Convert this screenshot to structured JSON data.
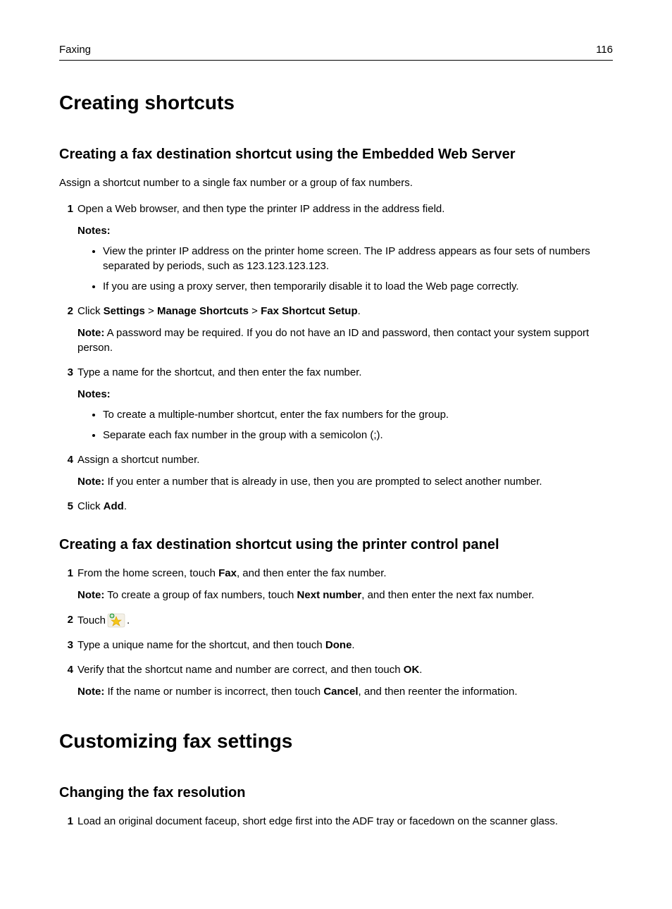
{
  "header": {
    "section": "Faxing",
    "page": "116"
  },
  "h1_a": "Creating shortcuts",
  "sec1": {
    "title": "Creating a fax destination shortcut using the Embedded Web Server",
    "intro": "Assign a shortcut number to a single fax number or a group of fax numbers.",
    "step1": "Open a Web browser, and then type the printer IP address in the address field.",
    "notes1_label": "Notes:",
    "note1a": "View the printer IP address on the printer home screen. The IP address appears as four sets of numbers separated by periods, such as 123.123.123.123.",
    "note1b": "If you are using a proxy server, then temporarily disable it to load the Web page correctly.",
    "step2_pre": "Click ",
    "step2_b1": "Settings",
    "step2_gt1": " > ",
    "step2_b2": "Manage Shortcuts",
    "step2_gt2": " > ",
    "step2_b3": "Fax Shortcut Setup",
    "step2_post": ".",
    "step2_note_label": "Note:",
    "step2_note": " A password may be required. If you do not have an ID and password, then contact your system support person.",
    "step3": "Type a name for the shortcut, and then enter the fax number.",
    "notes3_label": "Notes:",
    "note3a": "To create a multiple‑number shortcut, enter the fax numbers for the group.",
    "note3b": "Separate each fax number in the group with a semicolon (;).",
    "step4": "Assign a shortcut number.",
    "step4_note_label": "Note:",
    "step4_note": " If you enter a number that is already in use, then you are prompted to select another number.",
    "step5_pre": "Click ",
    "step5_b": "Add",
    "step5_post": "."
  },
  "sec2": {
    "title": "Creating a fax destination shortcut using the printer control panel",
    "step1_pre": "From the home screen, touch ",
    "step1_b": "Fax",
    "step1_post": ", and then enter the fax number.",
    "step1_note_label": "Note:",
    "step1_note_a": " To create a group of fax numbers, touch ",
    "step1_note_b": "Next number",
    "step1_note_c": ", and then enter the next fax number.",
    "step2_pre": "Touch ",
    "step2_post": ".",
    "step3_pre": "Type a unique name for the shortcut, and then touch ",
    "step3_b": "Done",
    "step3_post": ".",
    "step4_pre": "Verify that the shortcut name and number are correct, and then touch ",
    "step4_b": "OK",
    "step4_post": ".",
    "step4_note_label": "Note:",
    "step4_note_a": " If the name or number is incorrect, then touch ",
    "step4_note_b": "Cancel",
    "step4_note_c": ", and then reenter the information."
  },
  "h1_b": "Customizing fax settings",
  "sec3": {
    "title": "Changing the fax resolution",
    "step1": "Load an original document faceup, short edge first into the ADF tray or facedown on the scanner glass."
  }
}
